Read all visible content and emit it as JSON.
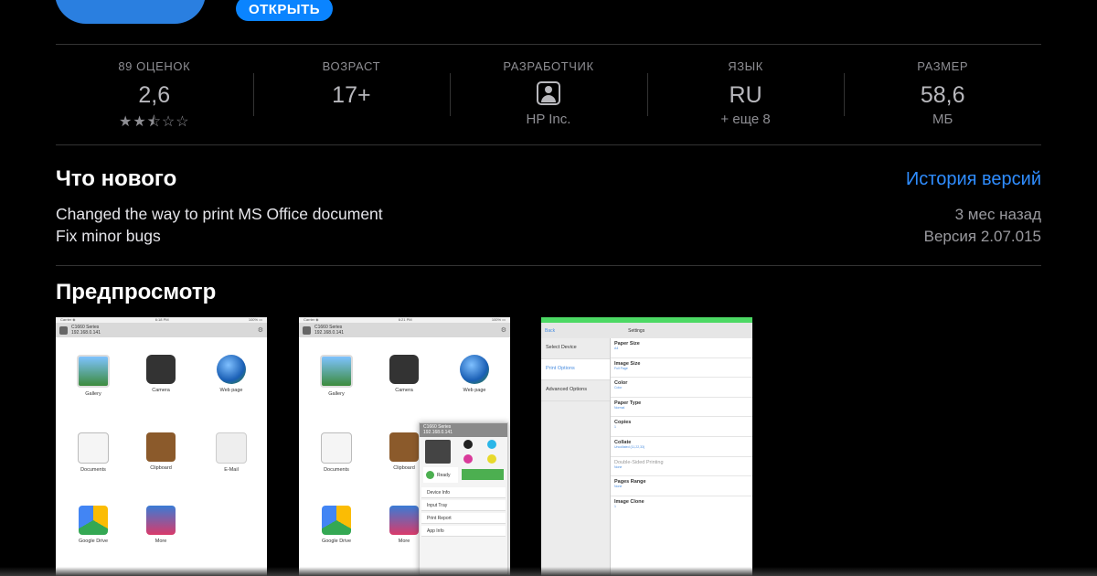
{
  "header": {
    "open_button": "ОТКРЫТЬ"
  },
  "stats": [
    {
      "label": "89 ОЦЕНОК",
      "value": "2,6",
      "stars": "★★⯪☆☆",
      "rating": 2.6
    },
    {
      "label": "ВОЗРАСТ",
      "value": "17+"
    },
    {
      "label": "РАЗРАБОТЧИК",
      "icon": "person-icon",
      "sub": "HP Inc."
    },
    {
      "label": "ЯЗЫК",
      "value": "RU",
      "sub": "+ еще 8"
    },
    {
      "label": "РАЗМЕР",
      "value": "58,6",
      "sub": "МБ"
    }
  ],
  "whats_new": {
    "title": "Что нового",
    "history_link": "История версий",
    "notes": [
      "Changed the way to print MS Office document",
      "Fix minor bugs"
    ],
    "date": "3 мес назад",
    "version": "Версия 2.07.015"
  },
  "preview": {
    "title": "Предпросмотр",
    "shot1": {
      "status_left": "Carrier ◈",
      "status_center": "6:18 PM",
      "status_right": "100% ▭",
      "printer": "C1660 Series",
      "ip": "192.168.0.141",
      "icons": [
        "Gallery",
        "Camera",
        "Web page",
        "Documents",
        "Clipboard",
        "E-Mail",
        "Google Drive",
        "More"
      ]
    },
    "shot2": {
      "status_left": "Carrier ◈",
      "status_center": "6:21 PM",
      "status_right": "100% ▭",
      "printer": "C1660 Series",
      "ip": "192.168.0.141",
      "icons": [
        "Gallery",
        "Camera",
        "Web page",
        "Documents",
        "Clipboard",
        "Google Drive",
        "More"
      ],
      "popup_title": "C1660 Series",
      "popup_ip": "192.168.0.141",
      "ready": "Ready",
      "menu": [
        "Device Info",
        "Input Tray",
        "Print Report",
        "App Info"
      ]
    },
    "shot3": {
      "back": "Back",
      "title": "Settings",
      "left_menu": [
        "Select Device",
        "Print Options",
        "Advanced Options"
      ],
      "options": [
        {
          "name": "Paper Size",
          "value": "A4"
        },
        {
          "name": "Image Size",
          "value": "Full Page"
        },
        {
          "name": "Color",
          "value": "Color"
        },
        {
          "name": "Paper Type",
          "value": "Normal"
        },
        {
          "name": "Copies",
          "value": "1"
        },
        {
          "name": "Collate",
          "value": "Uncollated (11,22,33)"
        },
        {
          "name": "Double-Sided Printing",
          "value": "None"
        },
        {
          "name": "Pages Range",
          "value": "None"
        },
        {
          "name": "Image Clone",
          "value": "1"
        }
      ]
    }
  },
  "colors": {
    "accent": "#0a84ff",
    "link": "#2f8dff",
    "background": "#000000"
  }
}
